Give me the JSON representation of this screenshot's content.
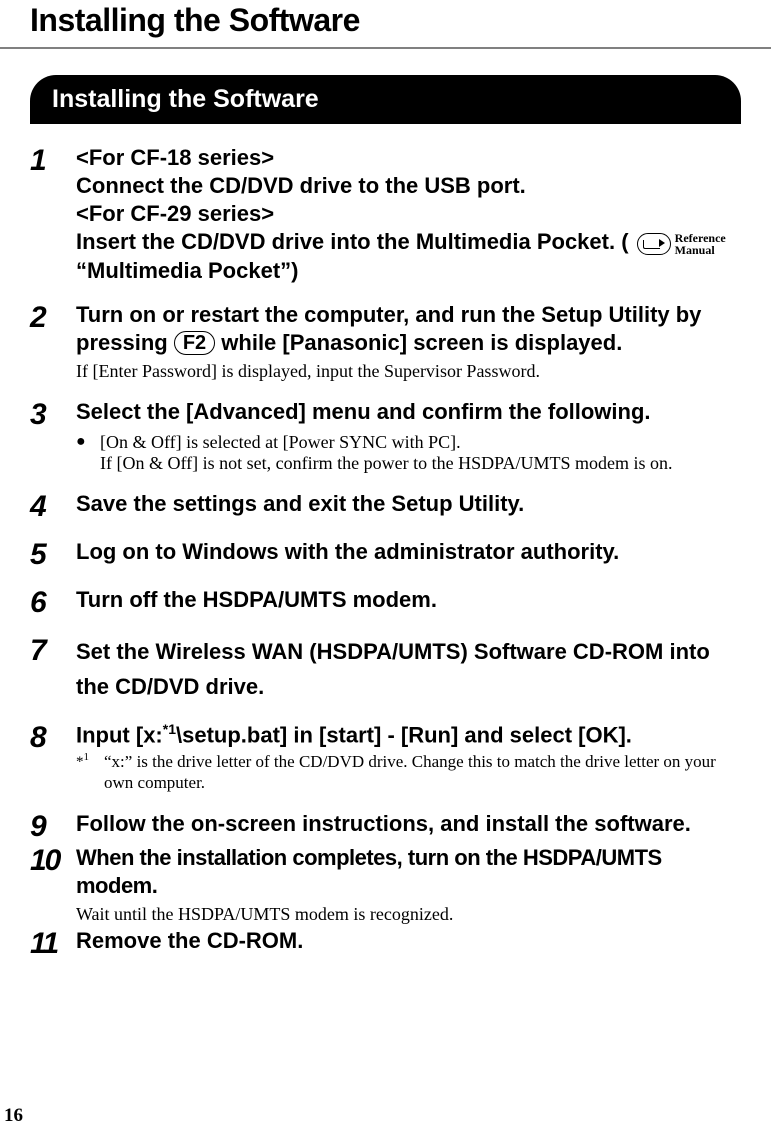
{
  "page": {
    "title": "Installing the Software",
    "section_heading": "Installing the Software",
    "page_number": "16",
    "reference_label": "Reference\nManual",
    "key_f2": "F2"
  },
  "steps": [
    {
      "num": "1",
      "head_lines": [
        "<For CF-18 series>",
        "Connect the CD/DVD drive to the USB port.",
        "<For CF-29 series>"
      ],
      "head_with_ref_prefix": "Insert the CD/DVD drive into the Multimedia Pocket. (",
      "head_with_ref_suffix": "",
      "head_after_ref": "“Multimedia Pocket”)"
    },
    {
      "num": "2",
      "head_prefix": "Turn on or restart the computer, and run the Setup Utility by pressing ",
      "head_suffix": " while [Panasonic] screen is displayed.",
      "note": "If [Enter Password] is displayed, input the Supervisor Password."
    },
    {
      "num": "3",
      "head": "Select the [Advanced] menu and confirm the following.",
      "bullet_line1": "[On & Off] is selected at [Power SYNC with PC].",
      "bullet_line2": "If [On & Off] is not set, confirm the power to the HSDPA/UMTS modem is on."
    },
    {
      "num": "4",
      "head": "Save the settings and exit the Setup Utility."
    },
    {
      "num": "5",
      "head": "Log on to Windows with the administrator authority."
    },
    {
      "num": "6",
      "head": "Turn off the HSDPA/UMTS modem."
    },
    {
      "num": "7",
      "head": "Set the Wireless WAN (HSDPA/UMTS) Software CD-ROM into the CD/DVD drive."
    },
    {
      "num": "8",
      "head_prefix": "Input [x:",
      "head_star": "*1",
      "head_suffix": "\\setup.bat] in [start] - [Run] and select [OK].",
      "fn_mark": "*1",
      "fn_text": "“x:” is the drive letter of the CD/DVD drive. Change this to match the drive letter on your own computer."
    },
    {
      "num": "9",
      "head": "Follow the on-screen instructions, and install the software."
    },
    {
      "num": "10",
      "head": "When the installation completes, turn on the HSDPA/UMTS modem.",
      "note": "Wait until the HSDPA/UMTS modem is recognized."
    },
    {
      "num": "11",
      "head": "Remove the CD-ROM."
    }
  ]
}
